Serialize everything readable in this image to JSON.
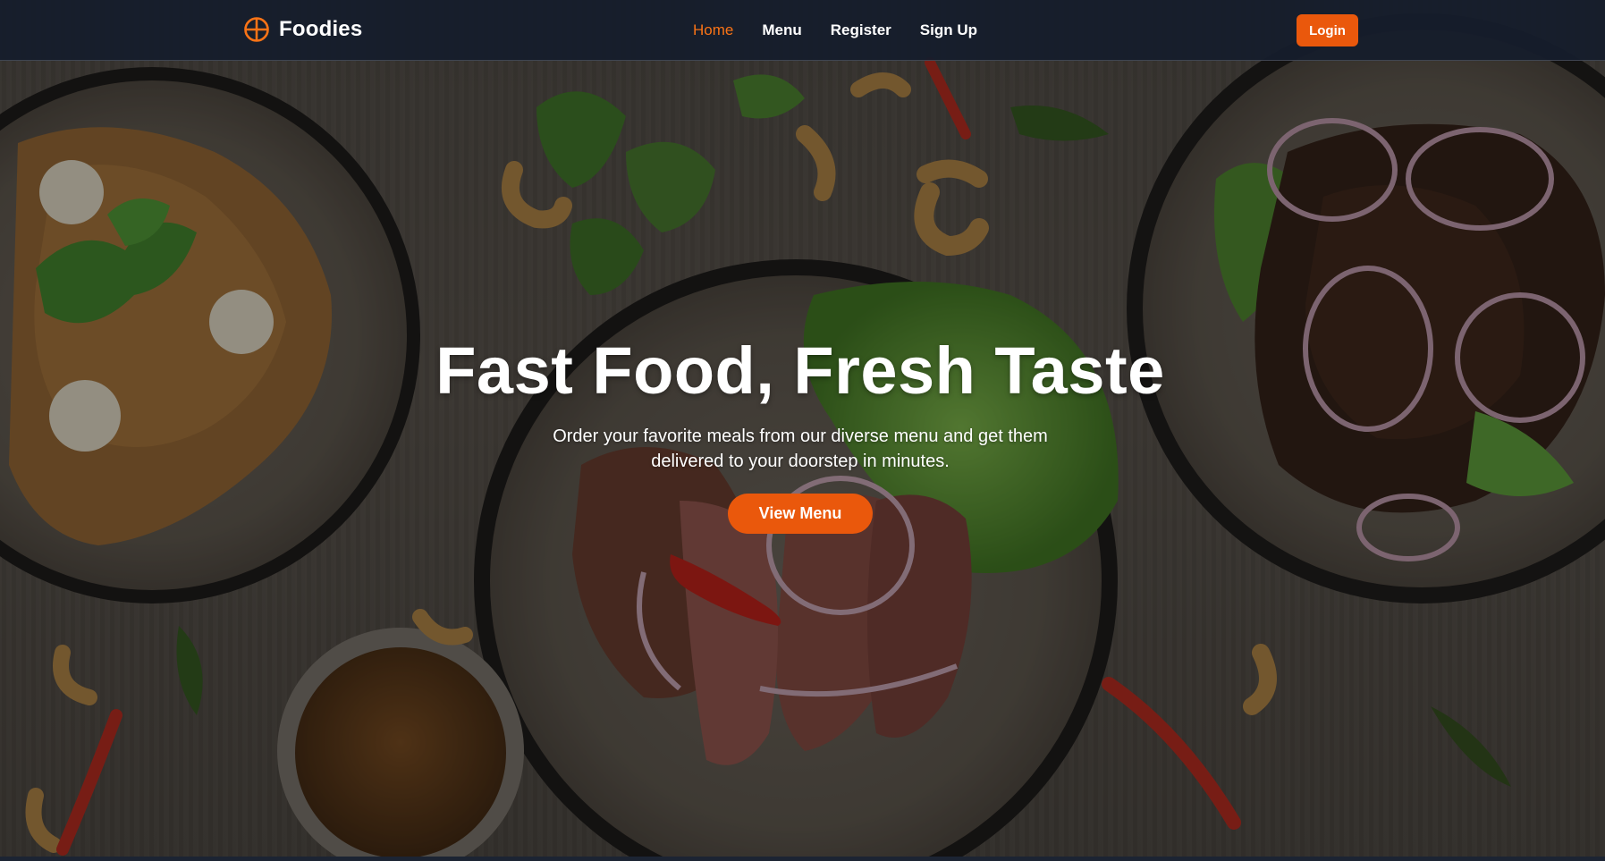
{
  "brand": {
    "name": "Foodies",
    "icon": "plate-cross-icon"
  },
  "nav": {
    "items": [
      {
        "label": "Home",
        "active": true
      },
      {
        "label": "Menu",
        "active": false
      },
      {
        "label": "Register",
        "active": false
      },
      {
        "label": "Sign Up",
        "active": false
      }
    ],
    "login_label": "Login"
  },
  "hero": {
    "title": "Fast Food, Fresh Taste",
    "subtitle": "Order your favorite meals from our diverse menu and get them delivered to your doorstep in minutes.",
    "cta_label": "View Menu",
    "background": "food-table-photo"
  },
  "colors": {
    "accent": "#ea580c",
    "nav_active": "#f97316",
    "navbar_bg": "#151d2c",
    "text": "#ffffff"
  }
}
